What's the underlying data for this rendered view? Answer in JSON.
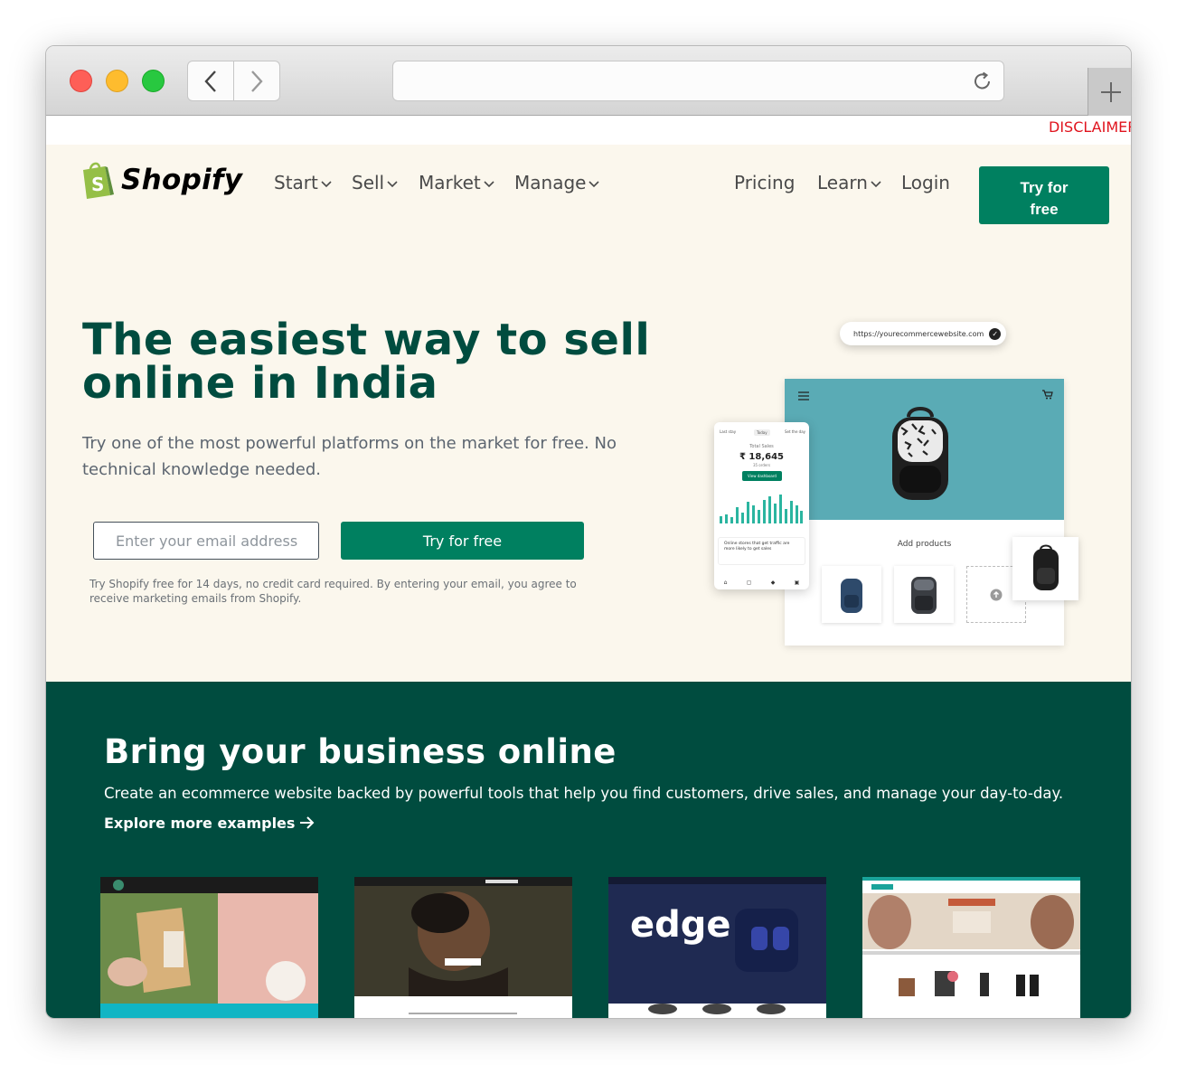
{
  "browser": {
    "disclaimer": "DISCLAIMER"
  },
  "header": {
    "logo_text": "Shopify",
    "nav": [
      {
        "label": "Start"
      },
      {
        "label": "Sell"
      },
      {
        "label": "Market"
      },
      {
        "label": "Manage"
      }
    ],
    "right_nav": {
      "pricing": "Pricing",
      "learn": "Learn",
      "login": "Login"
    },
    "cta_line1": "Try for",
    "cta_line2": "free"
  },
  "hero": {
    "title": "The easiest way to sell online in India",
    "subtitle": "Try one of the most powerful platforms on the market for free. No technical knowledge needed.",
    "email_placeholder": "Enter your email address",
    "cta": "Try for free",
    "fine_print": "Try Shopify free for 14 days, no credit card required. By entering your email, you agree to receive marketing emails from Shopify."
  },
  "mockup": {
    "url": "https://yourecommercewebsite.com",
    "add_products": "Add products",
    "phone": {
      "tab_left": "Last stay",
      "tab_mid": "Today",
      "tab_right": "Set the day",
      "sales_label": "Total Sales",
      "amount": "₹ 18,645",
      "orders": "35 orders",
      "button": "View dashboard",
      "notification": "Online stores that get traffic are more likely to get sales"
    }
  },
  "section": {
    "title": "Bring your business online",
    "subtitle": "Create an ecommerce website backed by powerful tools that help you find customers, drive sales, and manage your day-to-day.",
    "link": "Explore more examples"
  },
  "examples": [
    {
      "name": "example-store-1"
    },
    {
      "name": "example-store-2"
    },
    {
      "name": "example-store-edge",
      "text": "edge"
    },
    {
      "name": "example-store-4"
    }
  ],
  "colors": {
    "brand_green": "#008060",
    "dark_green": "#004c3f",
    "hero_bg": "#fbf7ed",
    "disclaimer_red": "#e0141e"
  }
}
